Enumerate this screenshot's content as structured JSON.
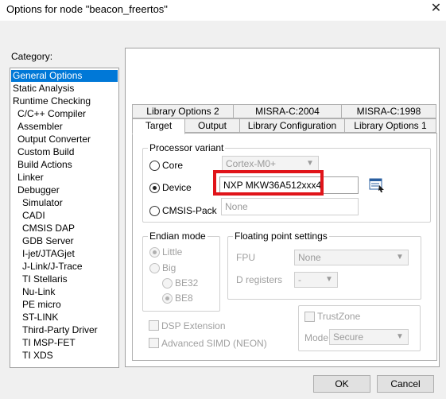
{
  "window": {
    "title": "Options for node \"beacon_freertos\"",
    "close_icon": "close-icon"
  },
  "category": {
    "label": "Category:",
    "items": [
      "General Options",
      "Static Analysis",
      "Runtime Checking",
      "C/C++ Compiler",
      "Assembler",
      "Output Converter",
      "Custom Build",
      "Build Actions",
      "Linker",
      "Debugger",
      "Simulator",
      "CADI",
      "CMSIS DAP",
      "GDB Server",
      "I-jet/JTAGjet",
      "J-Link/J-Trace",
      "TI Stellaris",
      "Nu-Link",
      "PE micro",
      "ST-LINK",
      "Third-Party Driver",
      "TI MSP-FET",
      "TI XDS"
    ],
    "selected": "General Options"
  },
  "tabs": {
    "back_row": [
      "Library Options 2",
      "MISRA-C:2004",
      "MISRA-C:1998"
    ],
    "front_row": [
      "Target",
      "Output",
      "Library Configuration",
      "Library Options 1"
    ],
    "active": "Target"
  },
  "processor": {
    "group_title": "Processor variant",
    "core_label": "Core",
    "core_value": "Cortex-M0+",
    "device_label": "Device",
    "device_value": "NXP MKW36A512xxx4",
    "cmsis_label": "CMSIS-Pack",
    "cmsis_value": "None",
    "selected": "Device",
    "device_button_icon": "device-select-icon"
  },
  "endian": {
    "group_title": "Endian mode",
    "little": "Little",
    "big": "Big",
    "be32": "BE32",
    "be8": "BE8"
  },
  "floating": {
    "group_title": "Floating point settings",
    "fpu_label": "FPU",
    "fpu_value": "None",
    "dreg_label": "D registers",
    "dreg_value": "-"
  },
  "options": {
    "dsp_extension": "DSP Extension",
    "advanced_simd": "Advanced SIMD (NEON)",
    "trustzone": "TrustZone",
    "mode_label": "Mode",
    "mode_value": "Secure"
  },
  "buttons": {
    "ok": "OK",
    "cancel": "Cancel"
  },
  "colors": {
    "selection": "#0078d7",
    "highlight_box": "#e0141a"
  }
}
